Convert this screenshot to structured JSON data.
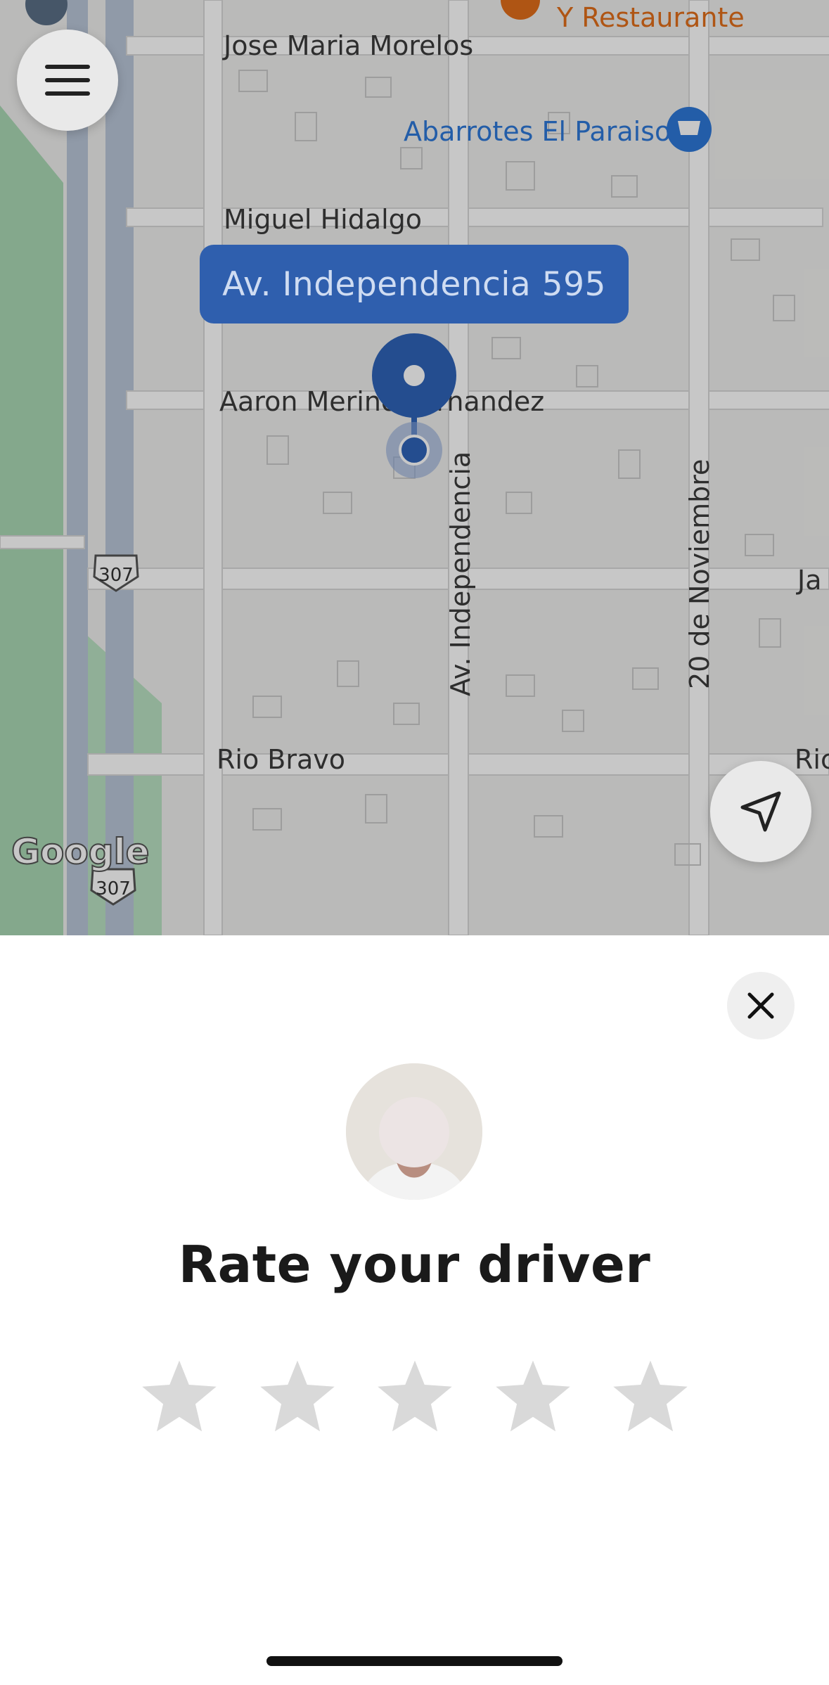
{
  "map": {
    "labels": {
      "street_jose_maria": "Jose Maria Morelos",
      "street_miguel": "Miguel Hidalgo",
      "street_aaron": "Aaron Merino Fernandez",
      "street_av_indep": "Av. Independencia",
      "street_20_nov": "20 de Noviembre",
      "street_rio_bravo": "Rio Bravo",
      "poi_restaurante": "Y Restaurante",
      "poi_abarrotes": "Abarrotes El Paraiso",
      "highway_1": "307",
      "highway_2": "307",
      "edge_ja": "Ja",
      "edge_ric": "Ric",
      "google_logo": "Google"
    },
    "pickup_address": "Av. Independencia 595",
    "colors": {
      "pin": "#2f63b8",
      "restaurant_poi": "#e06e1a",
      "shop_poi": "#2e78d8"
    }
  },
  "buttons": {
    "menu_icon": "hamburger-menu-icon",
    "locate_icon": "navigation-arrow-icon",
    "close_icon": "close-icon"
  },
  "rating": {
    "title": "Rate your driver",
    "max_stars": 5,
    "selected": 0,
    "star_color": "#d9d9d9"
  }
}
